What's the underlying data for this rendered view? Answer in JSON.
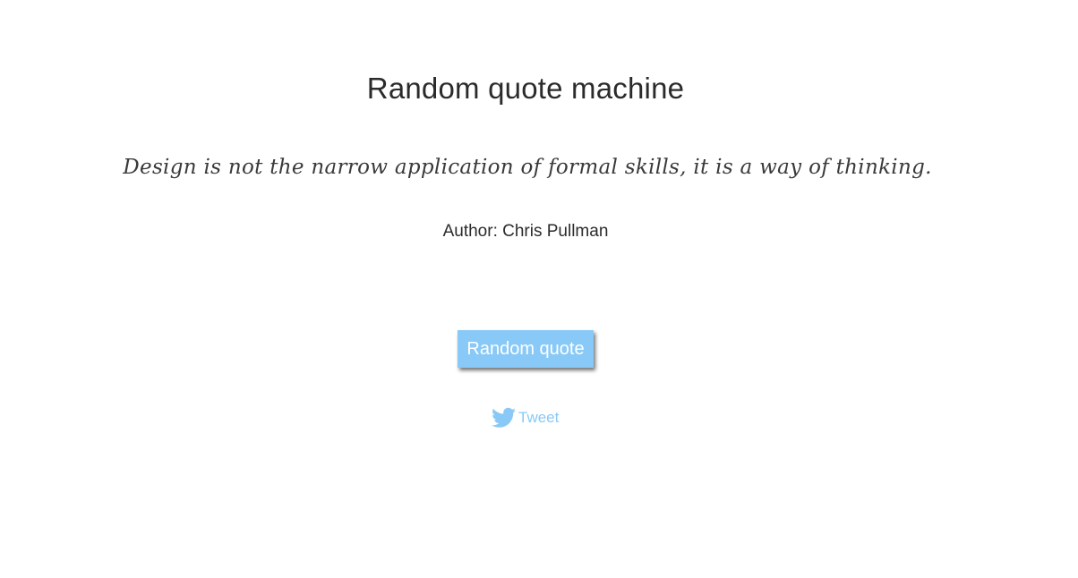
{
  "header": {
    "title": "Random quote machine"
  },
  "quote": {
    "text": "Design is not the narrow application of formal skills, it is a way of thinking.",
    "author_line": "Author: Chris Pullman"
  },
  "actions": {
    "random_button_label": "Random quote",
    "tweet_label": "Tweet",
    "tweet_icon": "twitter-bird-icon"
  },
  "colors": {
    "accent": "#88c9f7",
    "text": "#2b2b2b",
    "background": "#ffffff"
  }
}
